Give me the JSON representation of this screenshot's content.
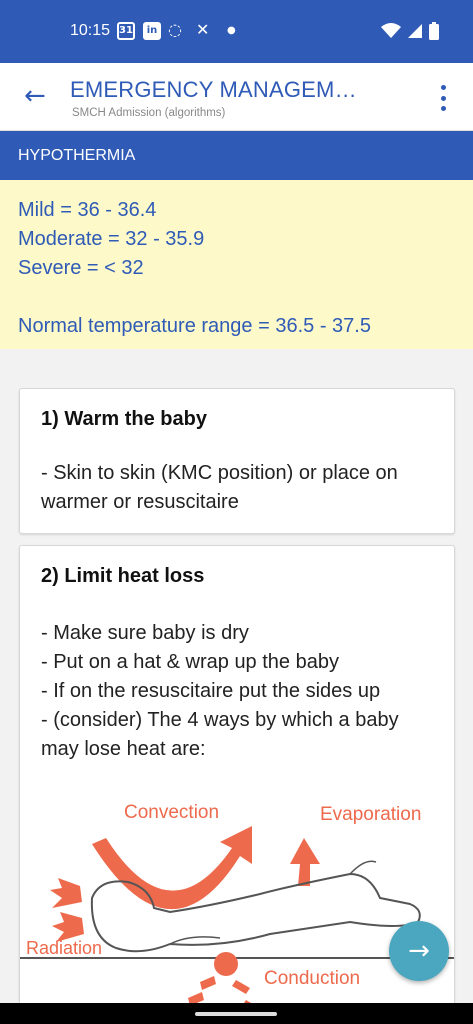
{
  "status_bar": {
    "time": "10:15",
    "icons": [
      "calendar-31-icon",
      "linkedin-icon",
      "whatsapp-icon",
      "app-x-icon",
      "dot-icon",
      "wifi-icon",
      "signal-icon",
      "battery-icon"
    ],
    "calendar_day": "31",
    "linkedin_text": "in"
  },
  "app_bar": {
    "title": "EMERGENCY MANAGEMENT",
    "subtitle": "SMCH Admission (algorithms)"
  },
  "section": {
    "title": "HYPOTHERMIA"
  },
  "info": {
    "lines": [
      "Mild = 36 - 36.4",
      "Moderate = 32 - 35.9",
      "Severe = < 32",
      "Normal temperature range = 36.5 - 37.5"
    ]
  },
  "cards": [
    {
      "title": "1) Warm the baby",
      "body": "- Skin to skin (KMC position) or place on warmer or resuscitaire"
    },
    {
      "title": "2) Limit heat loss",
      "lines": [
        "- Make sure baby is dry",
        "- Put on a hat & wrap up the baby",
        "- If on the resuscitaire put the sides up",
        "- (consider) The 4 ways by which a baby may lose heat are:"
      ]
    }
  ],
  "diagram": {
    "labels": {
      "convection": "Convection",
      "evaporation": "Evaporation",
      "radiation": "Radiation",
      "conduction": "Conduction"
    },
    "colors": {
      "arrow": "#ee6a4c",
      "line": "#555555"
    }
  },
  "colors": {
    "primary": "#2f5bb7",
    "info_bg": "#fdf9c9",
    "fab": "#4aa7bf"
  }
}
